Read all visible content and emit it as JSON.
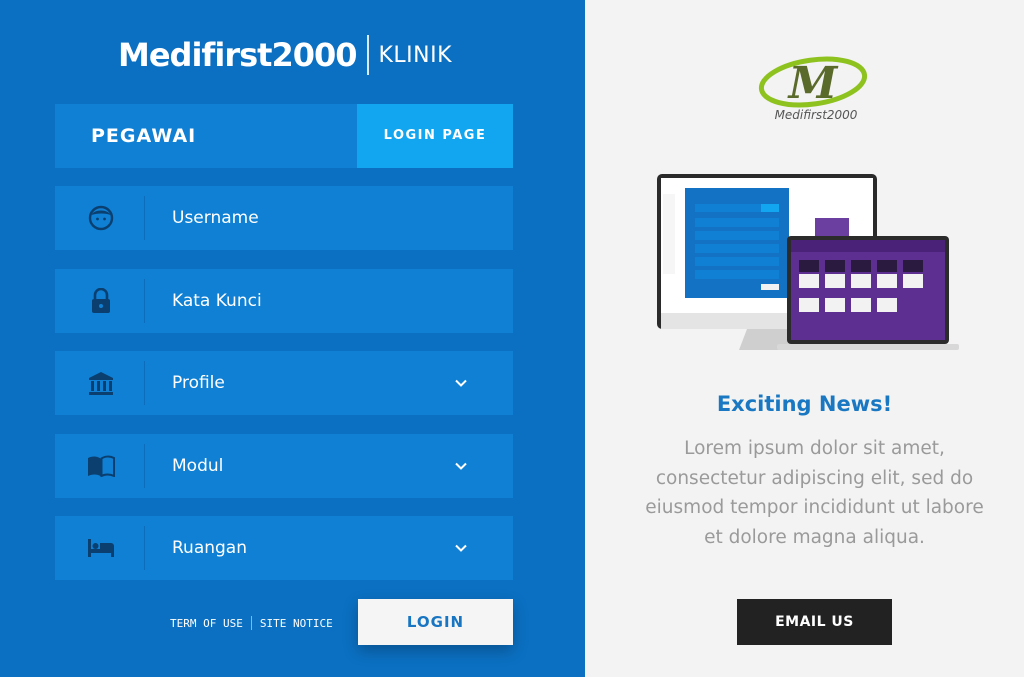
{
  "brand": {
    "name": "Medifirst2000",
    "subtitle": "KLINIK"
  },
  "tabs": {
    "role": "PEGAWAI",
    "login_page": "LOGIN PAGE"
  },
  "form": {
    "username": {
      "label": "Username",
      "icon": "face-icon"
    },
    "password": {
      "label": "Kata Kunci",
      "icon": "lock-icon"
    },
    "profile": {
      "label": "Profile",
      "icon": "bank-icon"
    },
    "modul": {
      "label": "Modul",
      "icon": "book-icon"
    },
    "ruangan": {
      "label": "Ruangan",
      "icon": "bed-icon"
    }
  },
  "footer": {
    "term_of_use": "TERM OF USE",
    "site_notice": "SITE NOTICE",
    "login_button": "LOGIN"
  },
  "side": {
    "logo_text": "Medifirst2000",
    "logo_letter": "M",
    "news_title": "Exciting News!",
    "news_lines": [
      "Lorem ipsum dolor sit amet,",
      "consectetur adipiscing elit, sed do",
      "eiusmod tempor incididunt ut labore",
      "et dolore magna aliqua."
    ],
    "email_button": "EMAIL US"
  },
  "colors": {
    "panel_blue": "#0b70c2",
    "field_blue": "#0f80d4",
    "tab_accent": "#12a6f0",
    "news_blue": "#1a78c2",
    "logo_green": "#8dc21f"
  }
}
